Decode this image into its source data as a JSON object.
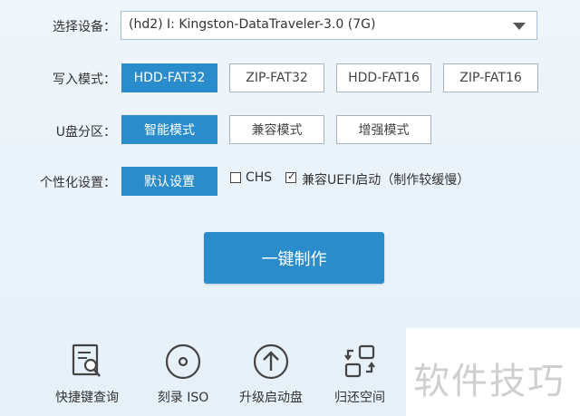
{
  "device": {
    "label": "选择设备：",
    "selected": "(hd2) I:  Kingston-DataTraveler-3.0 (7G)"
  },
  "write_mode": {
    "label": "写入模式：",
    "options": [
      "HDD-FAT32",
      "ZIP-FAT32",
      "HDD-FAT16",
      "ZIP-FAT16"
    ],
    "selected": "HDD-FAT32"
  },
  "partition": {
    "label": "U盘分区：",
    "options": [
      "智能模式",
      "兼容模式",
      "增强模式"
    ],
    "selected": "智能模式"
  },
  "personalize": {
    "label": "个性化设置：",
    "default_button": "默认设置",
    "chs_label": "CHS",
    "chs_checked": false,
    "uefi_label": "兼容UEFI启动（制作较缓慢）",
    "uefi_checked": true
  },
  "make_button": "一键制作",
  "tools": [
    {
      "label": "快捷键查询",
      "icon": "shortcut-query-icon"
    },
    {
      "label": "刻录 ISO",
      "icon": "disc-icon"
    },
    {
      "label": "升级启动盘",
      "icon": "upgrade-arrow-icon"
    },
    {
      "label": "归还空间",
      "icon": "restore-space-icon"
    }
  ],
  "watermark": "软件技巧",
  "colors": {
    "accent": "#2a8ccb",
    "background": "#e9f2f9"
  }
}
